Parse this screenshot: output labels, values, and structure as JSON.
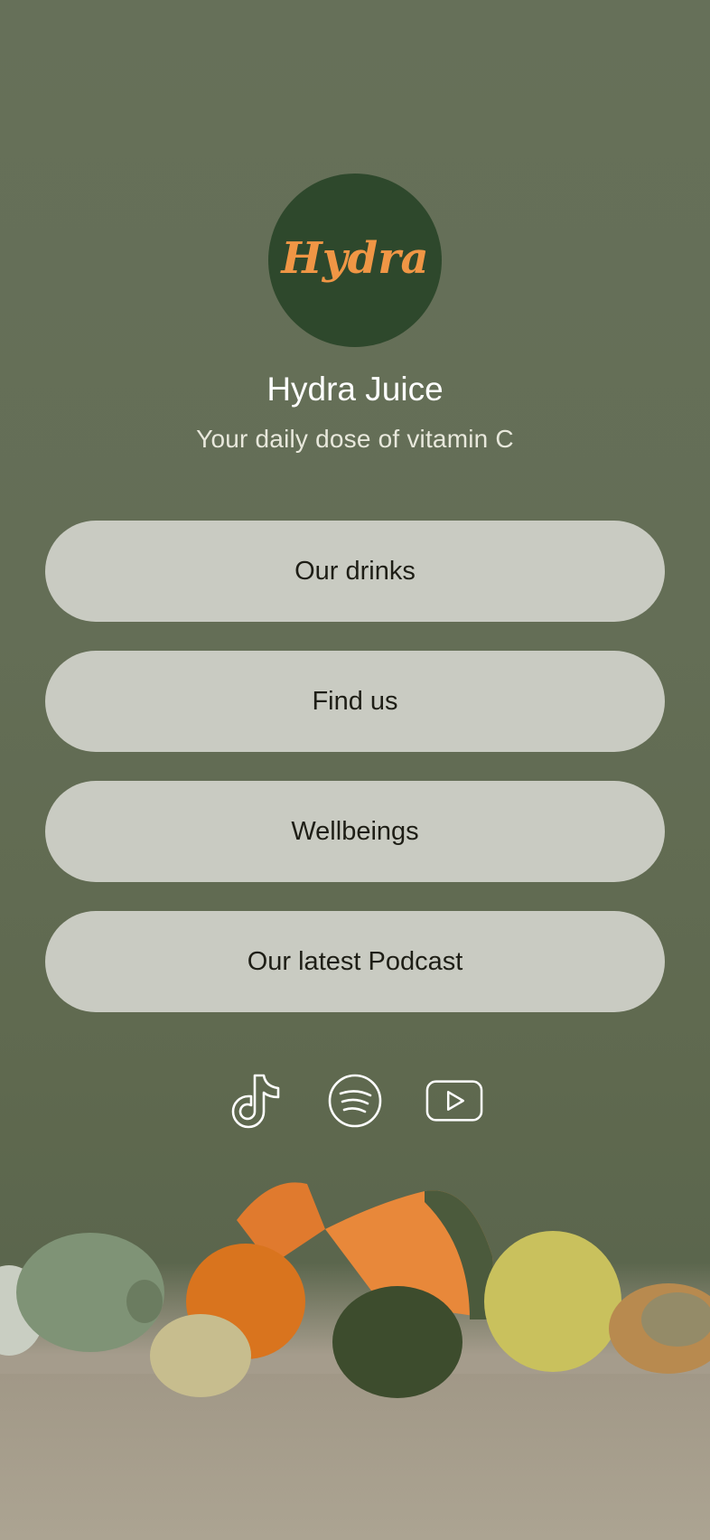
{
  "profile": {
    "logo_text": "Hydra",
    "name": "Hydra Juice",
    "tagline": "Your daily dose of vitamin C"
  },
  "links": [
    {
      "label": "Our drinks"
    },
    {
      "label": "Find us"
    },
    {
      "label": "Wellbeings"
    },
    {
      "label": "Our latest Podcast"
    }
  ],
  "socials": [
    {
      "icon": "tiktok-icon"
    },
    {
      "icon": "spotify-icon"
    },
    {
      "icon": "youtube-icon"
    }
  ],
  "colors": {
    "background": "#657058",
    "avatar_bg": "#2e482c",
    "logo_text": "#f09645",
    "button_bg": "#c9cbc2",
    "button_text": "#1e1e16"
  }
}
